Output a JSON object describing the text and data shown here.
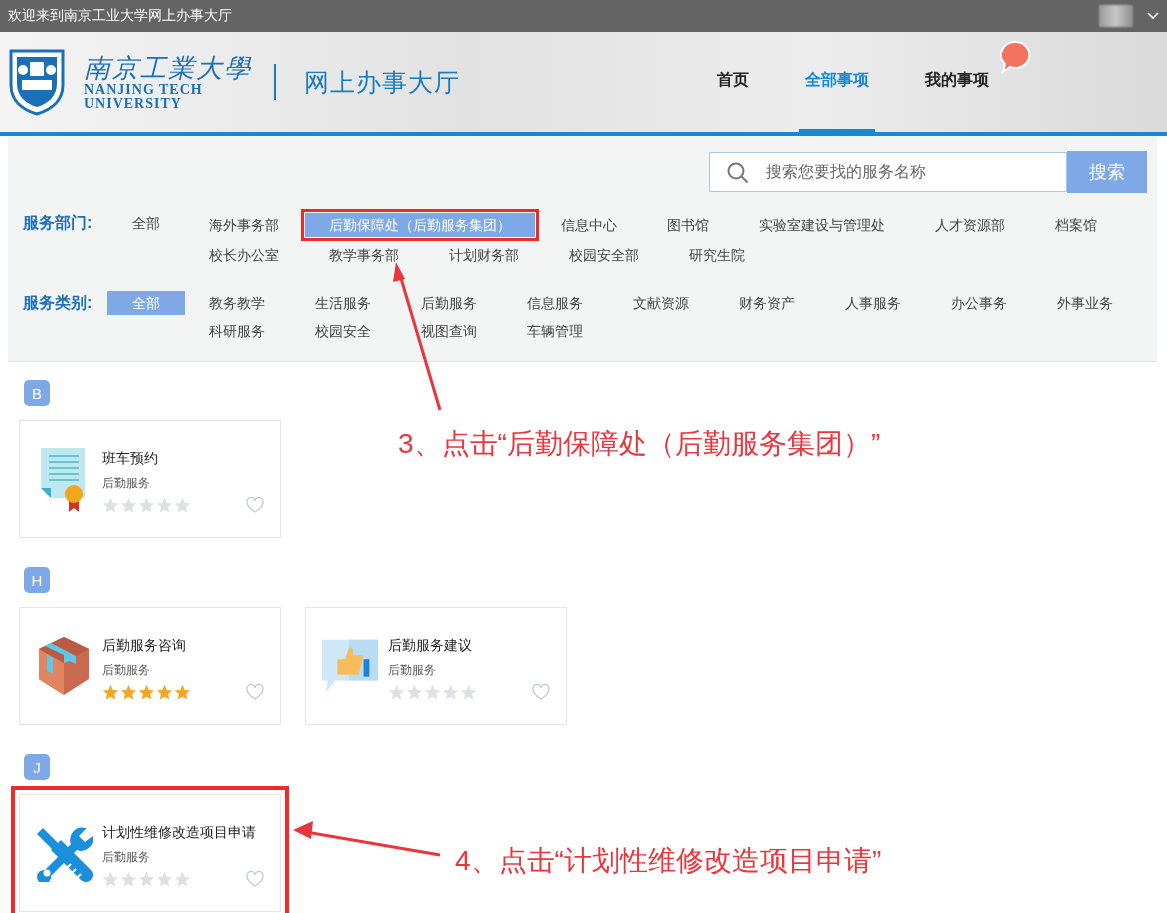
{
  "top_bar": {
    "welcome": "欢迎来到南京工业大学网上办事大厅"
  },
  "header": {
    "logo_name": "南京工業大學",
    "logo_en_1": "NANJING TECH",
    "logo_en_2": "UNIVERSITY",
    "site_title": "网上办事大厅",
    "nav": [
      {
        "label": "首页",
        "selected": false
      },
      {
        "label": "全部事项",
        "selected": true
      },
      {
        "label": "我的事项",
        "selected": false
      }
    ]
  },
  "search": {
    "placeholder": "搜索您要找的服务名称",
    "button": "搜索"
  },
  "filters": [
    {
      "label": "服务部门:",
      "items": [
        {
          "label": "全部",
          "selected": false,
          "highlighted": false
        },
        {
          "label": "海外事务部",
          "selected": false,
          "highlighted": false
        },
        {
          "label": "后勤保障处（后勤服务集团）",
          "selected": true,
          "highlighted": true
        },
        {
          "label": "信息中心",
          "selected": false,
          "highlighted": false
        },
        {
          "label": "图书馆",
          "selected": false,
          "highlighted": false
        },
        {
          "label": "实验室建设与管理处",
          "selected": false,
          "highlighted": false
        },
        {
          "label": "人才资源部",
          "selected": false,
          "highlighted": false
        },
        {
          "label": "档案馆",
          "selected": false,
          "highlighted": false
        },
        {
          "label": "校长办公室",
          "selected": false,
          "highlighted": false
        },
        {
          "label": "教学事务部",
          "selected": false,
          "highlighted": false
        },
        {
          "label": "计划财务部",
          "selected": false,
          "highlighted": false
        },
        {
          "label": "校园安全部",
          "selected": false,
          "highlighted": false
        },
        {
          "label": "研究生院",
          "selected": false,
          "highlighted": false
        }
      ]
    },
    {
      "label": "服务类别:",
      "items": [
        {
          "label": "全部",
          "selected": true,
          "highlighted": false
        },
        {
          "label": "教务教学",
          "selected": false,
          "highlighted": false
        },
        {
          "label": "生活服务",
          "selected": false,
          "highlighted": false
        },
        {
          "label": "后勤服务",
          "selected": false,
          "highlighted": false
        },
        {
          "label": "信息服务",
          "selected": false,
          "highlighted": false
        },
        {
          "label": "文献资源",
          "selected": false,
          "highlighted": false
        },
        {
          "label": "财务资产",
          "selected": false,
          "highlighted": false
        },
        {
          "label": "人事服务",
          "selected": false,
          "highlighted": false
        },
        {
          "label": "办公事务",
          "selected": false,
          "highlighted": false
        },
        {
          "label": "外事业务",
          "selected": false,
          "highlighted": false
        },
        {
          "label": "科研服务",
          "selected": false,
          "highlighted": false
        },
        {
          "label": "校园安全",
          "selected": false,
          "highlighted": false
        },
        {
          "label": "视图查询",
          "selected": false,
          "highlighted": false
        },
        {
          "label": "车辆管理",
          "selected": false,
          "highlighted": false
        }
      ]
    }
  ],
  "groups": [
    {
      "letter": "B",
      "cards": [
        {
          "kind": "certificate",
          "title": "班车预约",
          "category": "后勤服务",
          "stars": 0,
          "highlighted": false
        }
      ]
    },
    {
      "letter": "H",
      "cards": [
        {
          "kind": "box",
          "title": "后勤服务咨询",
          "category": "后勤服务",
          "stars": 5,
          "highlighted": false
        },
        {
          "kind": "thumbs-up",
          "title": "后勤服务建议",
          "category": "后勤服务",
          "stars": 0,
          "highlighted": false
        }
      ]
    },
    {
      "letter": "J",
      "cards": [
        {
          "kind": "tools",
          "title": "计划性维修改造项目申请",
          "category": "后勤服务",
          "stars": 0,
          "highlighted": true
        }
      ]
    }
  ],
  "annotations": [
    {
      "text": "3、点击“后勤保障处（后勤服务集团）”"
    },
    {
      "text": "4、点击“计划性维修改造项目申请”"
    }
  ]
}
